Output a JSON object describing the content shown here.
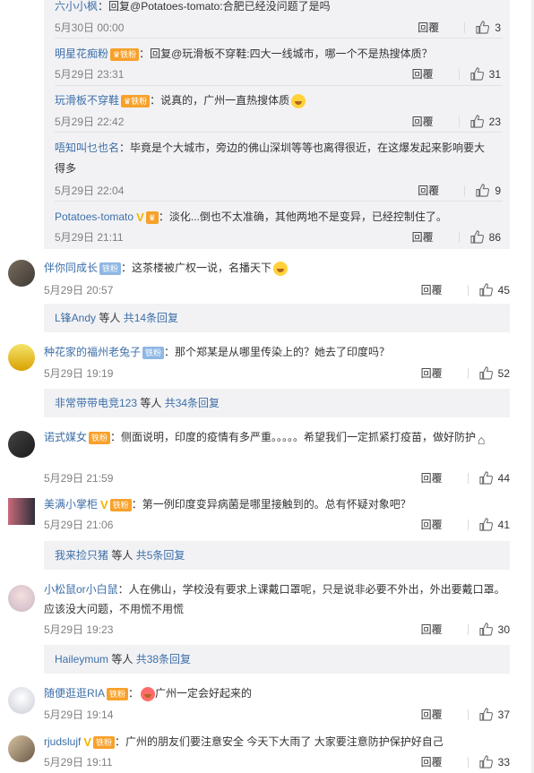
{
  "colors": {
    "name": "#eb7350",
    "link_blue": "#3d6fa8",
    "meta": "#808080",
    "panel_bg": "#f2f2f5"
  },
  "replies_top": [
    {
      "user": "六小小枫",
      "text": "：回复@Potatoes-tomato:合肥已经没问题了是吗",
      "time": "5月30日 00:00",
      "reply": "回覆",
      "likes": "3"
    },
    {
      "user": "明星花痴粉",
      "text": "：回复@玩滑板不穿鞋:四大一线城市，哪一个不是热搜体质？",
      "time": "5月29日 23:31",
      "reply": "回覆",
      "likes": "31"
    },
    {
      "user": "玩滑板不穿鞋",
      "text": "：说真的，广州一直热搜体质",
      "time": "5月29日 22:42",
      "reply": "回覆",
      "likes": "23"
    },
    {
      "user": "唔知叫乜也名",
      "text": "：毕竟是个大城市，旁边的佛山深圳等等也离得很近，在这爆发起来影响要大得多",
      "time": "5月29日 22:04",
      "reply": "回覆",
      "likes": "9"
    },
    {
      "user": "Potatoes-tomato",
      "text": "：淡化...倒也不太准确，其他两地不是变异，已经控制住了。",
      "time": "5月29日 21:11",
      "reply": "回覆",
      "likes": "86"
    }
  ],
  "comments": [
    {
      "user": "伴你同成长",
      "badge": "铁粉",
      "text": "：这茶楼被广权一说，名播天下",
      "time": "5月29日 20:57",
      "reply": "回覆",
      "likes": "45",
      "more": {
        "who": "L锋Andy",
        "mid": " 等人 ",
        "link": "共14条回复"
      }
    },
    {
      "user": "种花家的福州老兔子",
      "badge": "铁粉",
      "text": "：那个郑某是从哪里传染上的？她去了印度吗？",
      "time": "5月29日 19:19",
      "reply": "回覆",
      "likes": "52",
      "more": {
        "who": "非常带带电竞123",
        "mid": " 等人 ",
        "link": "共34条回复"
      }
    },
    {
      "user": "诺式媒女",
      "badge": "铁粉",
      "text": "：侧面说明，印度的疫情有多严重。。。。。希望我们一定抓紧打疫苗，做好防护",
      "time": "5月29日 21:59",
      "reply": "回覆",
      "likes": "44"
    },
    {
      "user": "美满小掌柜",
      "badge": "铁粉",
      "text": "：第一例印度变异病菌是哪里接触到的。总有怀疑对象吧？",
      "time": "5月29日 21:06",
      "reply": "回覆",
      "likes": "41",
      "more": {
        "who": "我来捡只猪",
        "mid": " 等人 ",
        "link": "共5条回复"
      }
    },
    {
      "user": "小松鼠or小白鼠",
      "text": "：人在佛山，学校没有要求上课戴口罩呢，只是说非必要不外出，外出要戴口罩。应该没大问题，不用慌不用慌",
      "time": "5月29日 19:23",
      "reply": "回覆",
      "likes": "30",
      "more": {
        "who": "Haileymum",
        "mid": " 等人 ",
        "link": "共38条回复"
      }
    },
    {
      "user": "随便逛逛RIA",
      "badge": "铁粉",
      "text": "广州一定会好起来的",
      "time": "5月29日 19:14",
      "reply": "回覆",
      "likes": "37"
    },
    {
      "user": "rjudslujf",
      "badge": "铁粉",
      "text": "：广州的朋友们要注意安全 今天下大雨了 大家要注意防护保护好自己",
      "time": "5月29日 19:11",
      "reply": "回覆",
      "likes": "33"
    }
  ],
  "icons": {
    "like": "thumbs-up-icon",
    "badge": "fan-badge-icon",
    "vip": "vip-v-icon",
    "emoji": "emoji-icon"
  }
}
